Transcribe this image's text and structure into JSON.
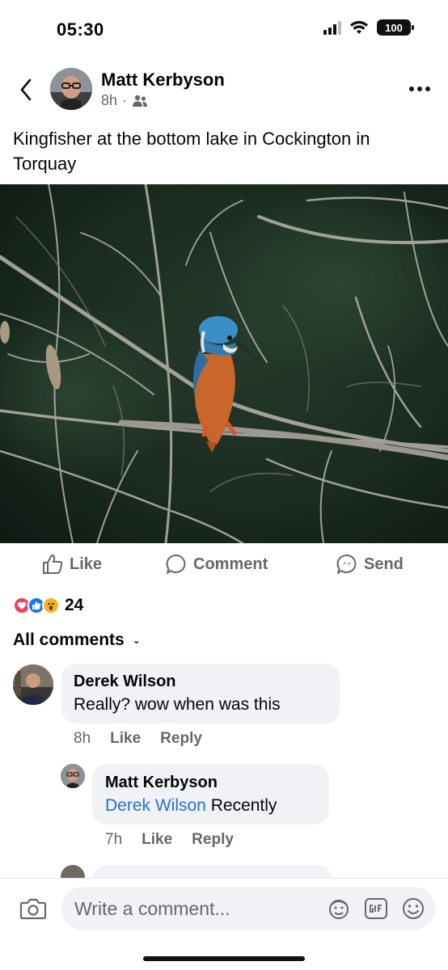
{
  "status_bar": {
    "time": "05:30",
    "battery": "100"
  },
  "post": {
    "author": "Matt Kerbyson",
    "age": "8h",
    "audience_icon": "friends-icon",
    "text": "Kingfisher at the bottom lake in Cockington in Torquay"
  },
  "actions": {
    "like": "Like",
    "comment": "Comment",
    "send": "Send"
  },
  "reactions": {
    "types": [
      "love",
      "like",
      "wow"
    ],
    "count": "24"
  },
  "comments_filter": {
    "label": "All comments"
  },
  "comments": [
    {
      "author": "Derek Wilson",
      "text": "Really? wow when was this",
      "time": "8h",
      "like": "Like",
      "reply": "Reply"
    },
    {
      "author": "Matt Kerbyson",
      "mention": "Derek Wilson",
      "text": "Recently",
      "time": "7h",
      "like": "Like",
      "reply": "Reply",
      "is_reply": true
    }
  ],
  "composer": {
    "placeholder": "Write a comment..."
  },
  "colors": {
    "mention": "#216fdb",
    "love": "#f33e58",
    "like": "#1877f2",
    "wow": "#f7b125",
    "secondary_text": "#65676b",
    "bubble": "#f0f2f5"
  }
}
